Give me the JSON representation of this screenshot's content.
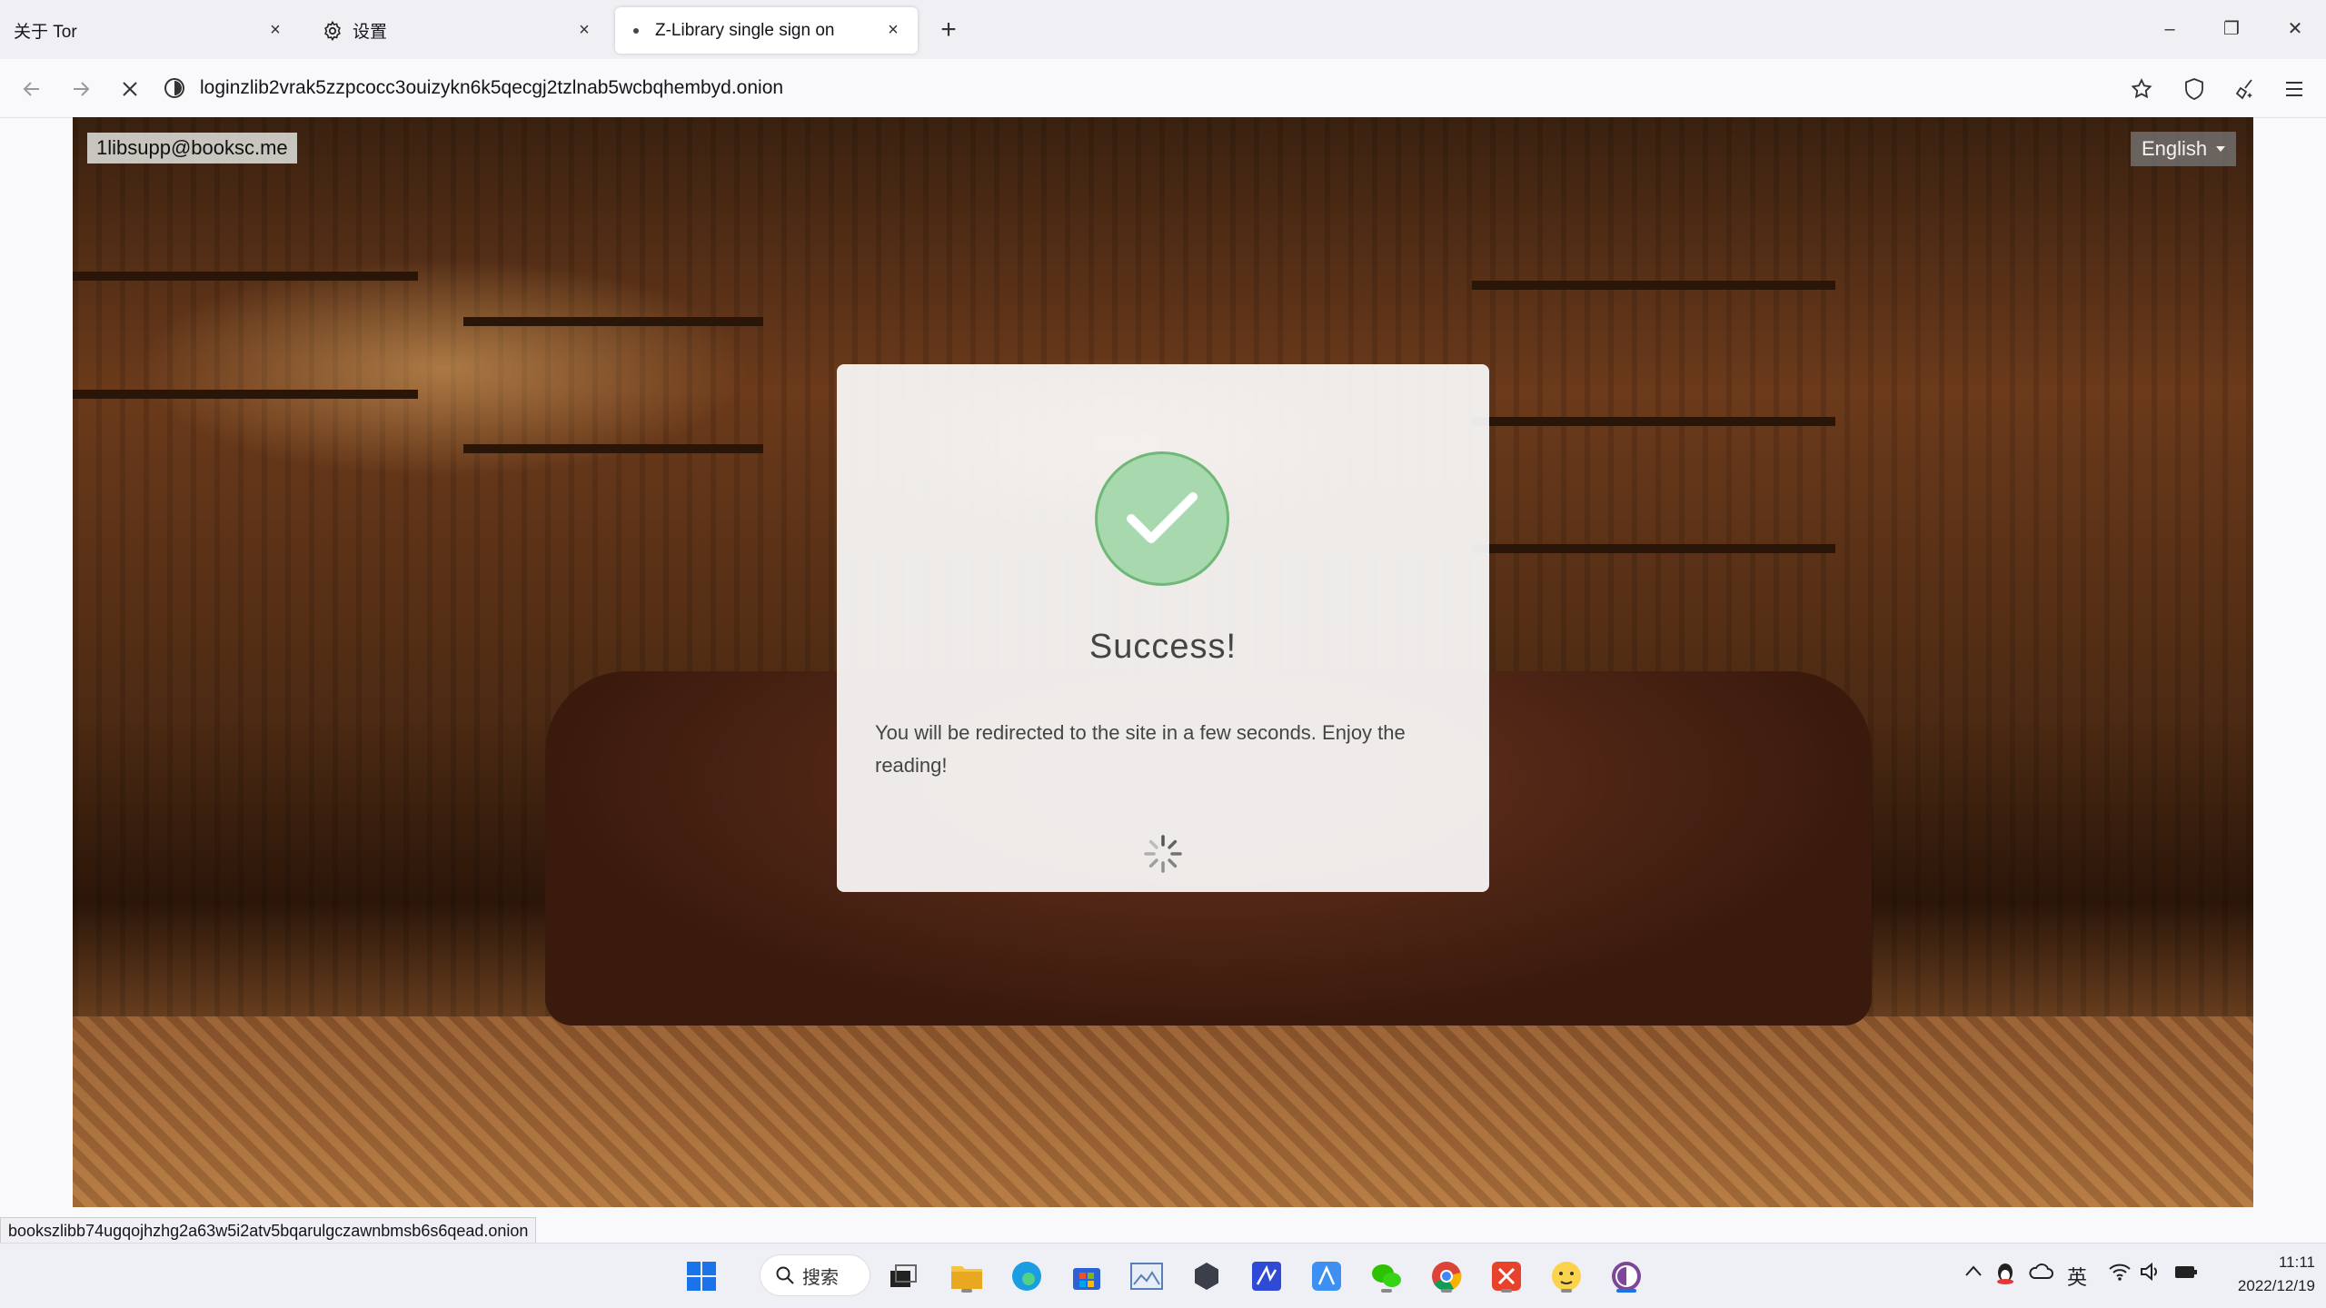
{
  "browser": {
    "tabs": [
      {
        "label": "关于 Tor",
        "close": "×"
      },
      {
        "label": "设置",
        "close": "×"
      },
      {
        "label": "Z-Library single sign on",
        "close": "×"
      }
    ],
    "new_tab": "+",
    "window_controls": {
      "minimize": "–",
      "restore": "❐",
      "close": "✕"
    },
    "url": "loginzlib2vrak5zzpcocc3ouizykn6k5qecgj2tzlnab5wcbqhembyd.onion"
  },
  "page": {
    "email_badge": "1libsupp@booksc.me",
    "language": "English",
    "modal": {
      "title": "Success!",
      "message": "You will be redirected to the site in a few seconds. Enjoy the reading!"
    }
  },
  "statusbar": {
    "link": "bookszlibb74ugqojhzhg2a63w5i2atv5bqarulgczawnbmsb6s6qead.onion"
  },
  "taskbar": {
    "search_label": "搜索",
    "ime_label": "英",
    "time": "11:11",
    "date": "2022/12/19"
  }
}
